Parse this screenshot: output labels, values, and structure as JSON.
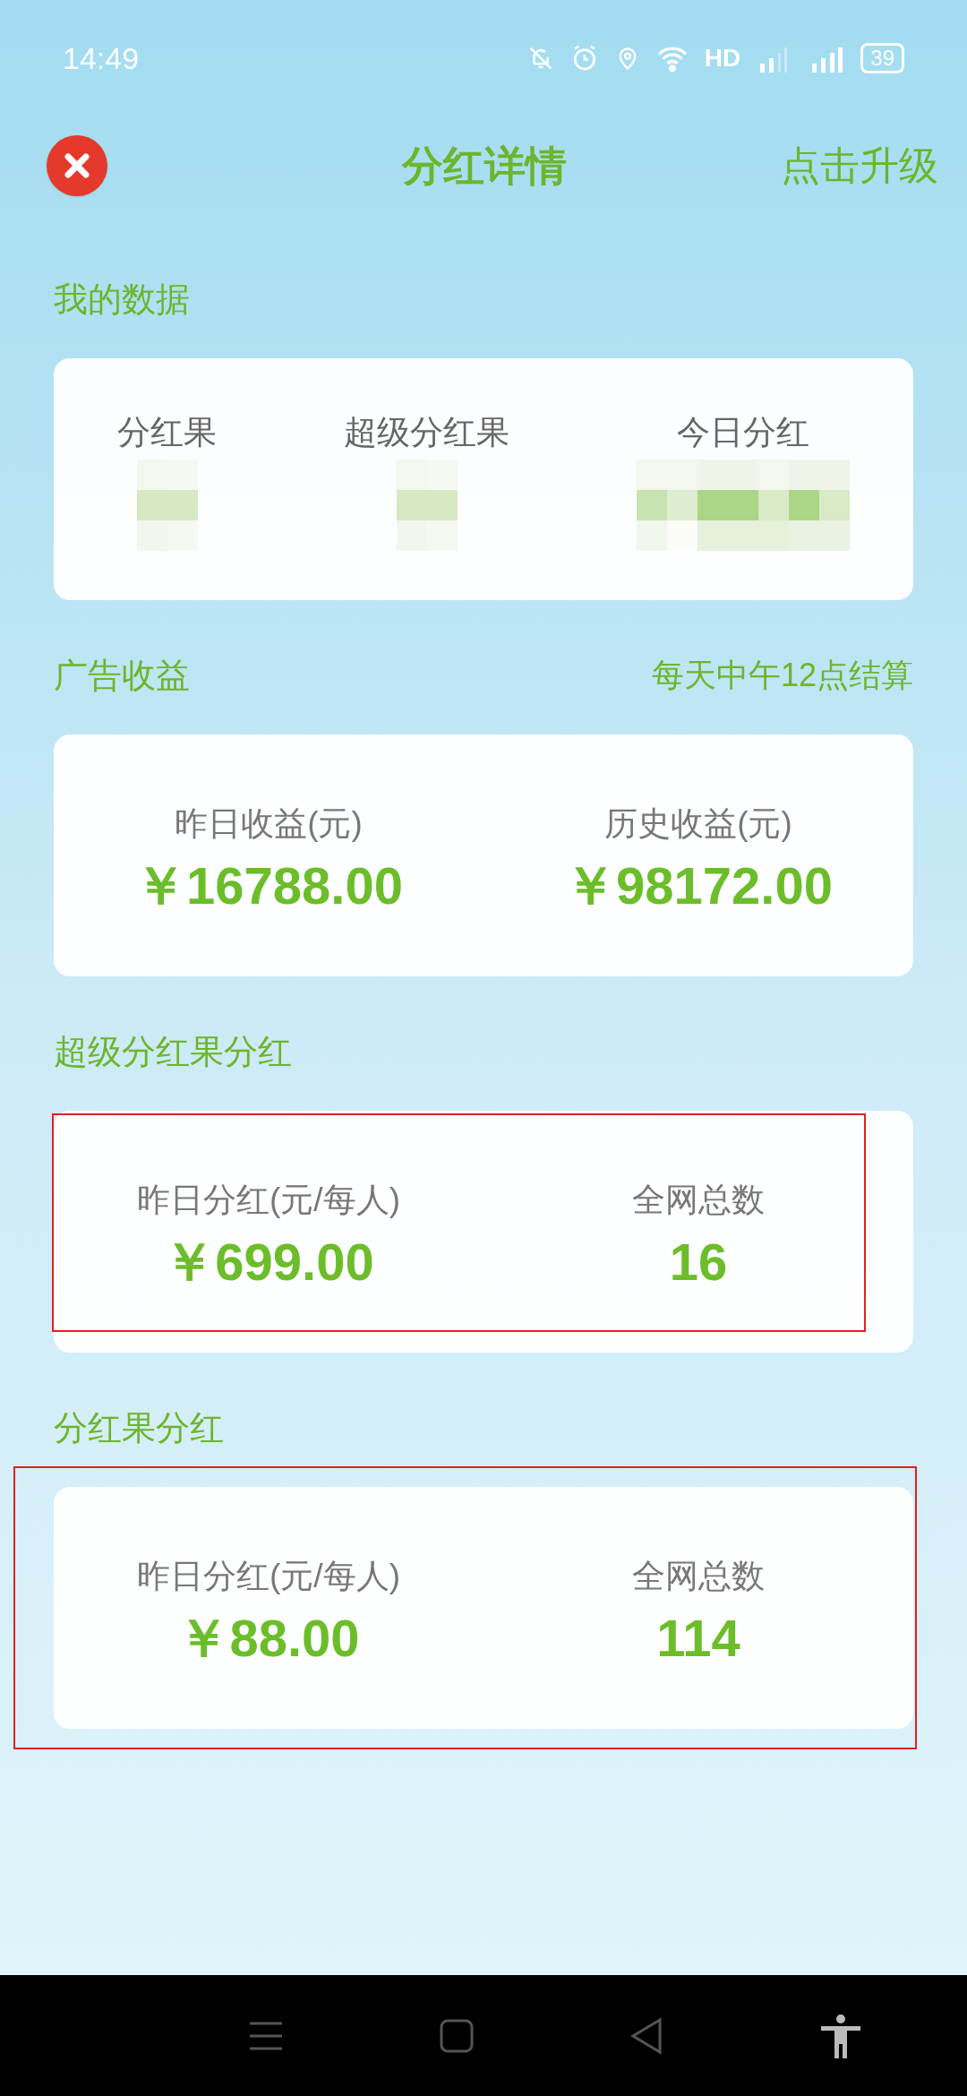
{
  "status_bar": {
    "time": "14:49",
    "network": "HD",
    "battery": "39"
  },
  "header": {
    "title": "分红详情",
    "action": "点击升级"
  },
  "sections": [
    {
      "kind": "stats",
      "title": "我的数据",
      "highlighted": false,
      "items": [
        {
          "label": "分红果"
        },
        {
          "label": "超级分红果"
        },
        {
          "label": "今日分红"
        }
      ]
    },
    {
      "kind": "amounts",
      "title": "广告收益",
      "note": "每天中午12点结算",
      "highlighted": false,
      "items": [
        {
          "label": "昨日收益(元)",
          "value": "￥16788.00"
        },
        {
          "label": "历史收益(元)",
          "value": "￥98172.00"
        }
      ]
    },
    {
      "kind": "amounts",
      "title": "超级分红果分红",
      "highlighted": true,
      "items": [
        {
          "label": "昨日分红(元/每人)",
          "value": "￥699.00"
        },
        {
          "label": "全网总数",
          "value": "16"
        }
      ]
    },
    {
      "kind": "amounts",
      "title": "分红果分红",
      "highlighted": true,
      "items": [
        {
          "label": "昨日分红(元/每人)",
          "value": "￥88.00"
        },
        {
          "label": "全网总数",
          "value": "114"
        }
      ]
    }
  ]
}
